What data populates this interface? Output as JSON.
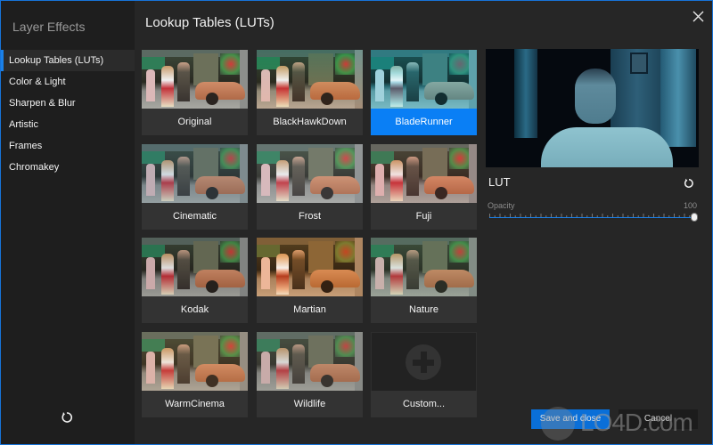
{
  "window": {
    "border_color": "#1773d8",
    "accent_color": "#0a7ff5"
  },
  "sidebar": {
    "title": "Layer Effects",
    "items": [
      {
        "label": "Lookup Tables (LUTs)",
        "active": true
      },
      {
        "label": "Color & Light",
        "active": false
      },
      {
        "label": "Sharpen & Blur",
        "active": false
      },
      {
        "label": "Artistic",
        "active": false
      },
      {
        "label": "Frames",
        "active": false
      },
      {
        "label": "Chromakey",
        "active": false
      }
    ],
    "reset_icon": "reset-icon"
  },
  "header": {
    "title": "Lookup Tables (LUTs)",
    "close_icon": "close-icon"
  },
  "luts": [
    {
      "label": "Original",
      "tint": "none",
      "selected": false
    },
    {
      "label": "BlackHawkDown",
      "tint": "teal-orange",
      "selected": false
    },
    {
      "label": "BladeRunner",
      "tint": "cyan",
      "selected": true
    },
    {
      "label": "Cinematic",
      "tint": "cool",
      "selected": false
    },
    {
      "label": "Frost",
      "tint": "cold",
      "selected": false
    },
    {
      "label": "Fuji",
      "tint": "vivid",
      "selected": false
    },
    {
      "label": "Kodak",
      "tint": "contrast",
      "selected": false
    },
    {
      "label": "Martian",
      "tint": "orange",
      "selected": false
    },
    {
      "label": "Nature",
      "tint": "green",
      "selected": false
    },
    {
      "label": "WarmCinema",
      "tint": "warm",
      "selected": false
    },
    {
      "label": "Wildlife",
      "tint": "muted",
      "selected": false
    },
    {
      "label": "Custom...",
      "tint": "custom",
      "selected": false,
      "icon": "plus-icon"
    }
  ],
  "properties": {
    "title": "LUT",
    "reset_icon": "reset-icon",
    "opacity": {
      "label": "Opacity",
      "value": "100",
      "min": 0,
      "max": 100,
      "current": 100
    }
  },
  "footer": {
    "save_label": "Save and close",
    "cancel_label": "Cancel"
  },
  "watermark": {
    "text": "LO4D.com"
  }
}
